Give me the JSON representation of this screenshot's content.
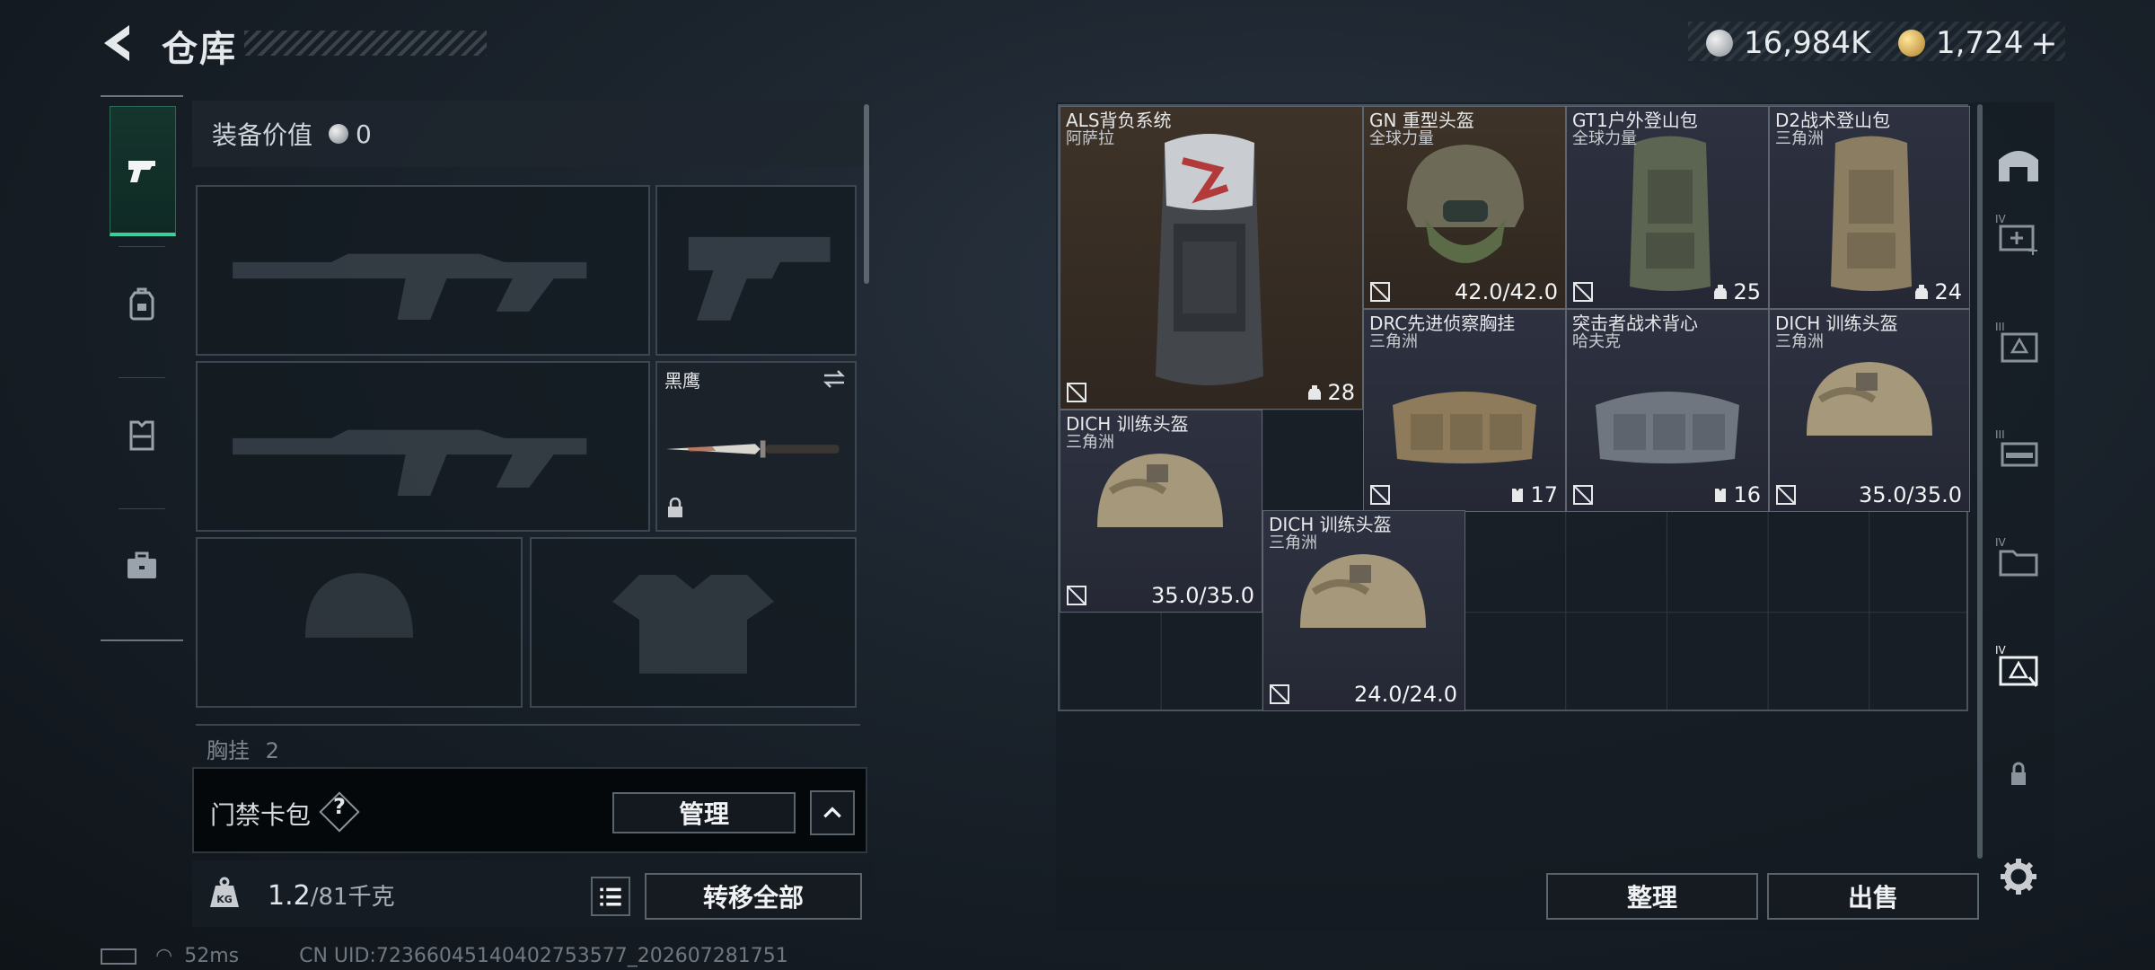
{
  "header": {
    "back_icon": "chevron-left-icon",
    "title": "仓库"
  },
  "currency": {
    "silver": {
      "icon": "silver-coin-icon",
      "amount": "16,984K"
    },
    "gold": {
      "icon": "gold-coin-icon",
      "amount": "1,724"
    },
    "add_label": "+"
  },
  "tabs": [
    {
      "name": "weapons",
      "icon": "pistol-icon",
      "active": true
    },
    {
      "name": "backpack",
      "icon": "backpack-icon",
      "active": false
    },
    {
      "name": "vest",
      "icon": "vest-icon",
      "active": false
    },
    {
      "name": "case",
      "icon": "briefcase-icon",
      "active": false
    }
  ],
  "loadout": {
    "value_label": "装备价值",
    "value_icon": "silver-coin-icon",
    "value": "0",
    "knife_name": "黑鹰",
    "chest_label": "胸挂",
    "chest_count": "2"
  },
  "cardpack": {
    "label": "门禁卡包",
    "help": "?",
    "manage_label": "管理"
  },
  "weight": {
    "current": "1.2",
    "max": "/81千克",
    "kg_icon": "weight-kg-icon"
  },
  "transfer_all_label": "转移全部",
  "inventory": {
    "items": [
      {
        "name": "ALS背负系统",
        "brand": "阿萨拉",
        "stat": "28",
        "stat_icon": "capacity-icon",
        "rarity": "brown"
      },
      {
        "name": "GN 重型头盔",
        "brand": "全球力量",
        "stat": "42.0/42.0",
        "stat_icon": "",
        "rarity": "brown"
      },
      {
        "name": "GT1户外登山包",
        "brand": "全球力量",
        "stat": "25",
        "stat_icon": "capacity-icon",
        "rarity": "purple"
      },
      {
        "name": "D2战术登山包",
        "brand": "三角洲",
        "stat": "24",
        "stat_icon": "capacity-icon",
        "rarity": "purple"
      },
      {
        "name": "DRC先进侦察胸挂",
        "brand": "三角洲",
        "stat": "17",
        "stat_icon": "vest-capacity-icon",
        "rarity": "purple"
      },
      {
        "name": "突击者战术背心",
        "brand": "哈夫克",
        "stat": "16",
        "stat_icon": "vest-capacity-icon",
        "rarity": "purple"
      },
      {
        "name": "DICH 训练头盔",
        "brand": "三角洲",
        "stat": "35.0/35.0",
        "stat_icon": "",
        "rarity": "purple"
      },
      {
        "name": "DICH 训练头盔",
        "brand": "三角洲",
        "stat": "35.0/35.0",
        "stat_icon": "",
        "rarity": "purple"
      },
      {
        "name": "DICH 训练头盔",
        "brand": "三角洲",
        "stat": "24.0/24.0",
        "stat_icon": "",
        "rarity": "purple"
      }
    ],
    "sort_label": "整理",
    "sell_label": "出售"
  },
  "side": {
    "levels": [
      "IV",
      "III",
      "III",
      "IV",
      "IV"
    ]
  },
  "status": {
    "ping": "52ms",
    "uid": "CN UID:7236604514040​2753577_202607281751"
  }
}
